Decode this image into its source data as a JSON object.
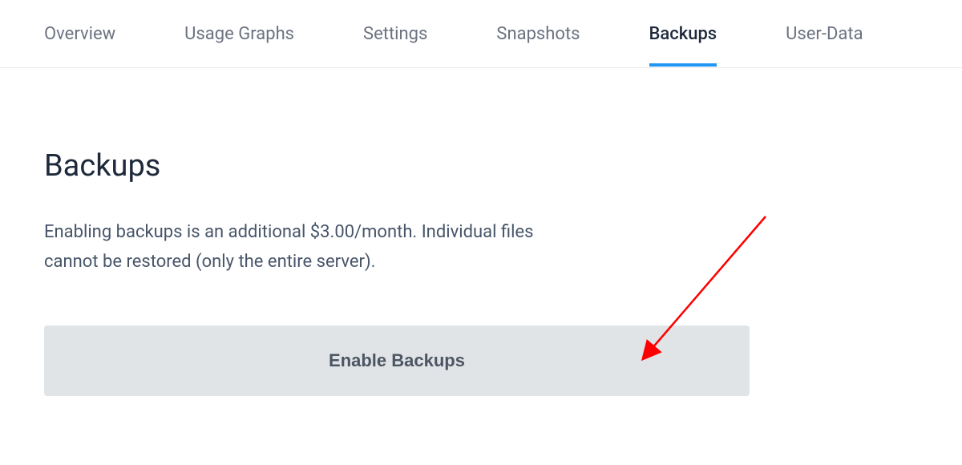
{
  "tabs": {
    "items": [
      {
        "label": "Overview",
        "active": false
      },
      {
        "label": "Usage Graphs",
        "active": false
      },
      {
        "label": "Settings",
        "active": false
      },
      {
        "label": "Snapshots",
        "active": false
      },
      {
        "label": "Backups",
        "active": true
      },
      {
        "label": "User-Data",
        "active": false
      }
    ]
  },
  "page": {
    "title": "Backups",
    "description": "Enabling backups is an additional $3.00/month. Individual files cannot be restored (only the entire server).",
    "button_label": "Enable Backups"
  },
  "annotation": {
    "type": "arrow",
    "color": "#ff0000"
  }
}
